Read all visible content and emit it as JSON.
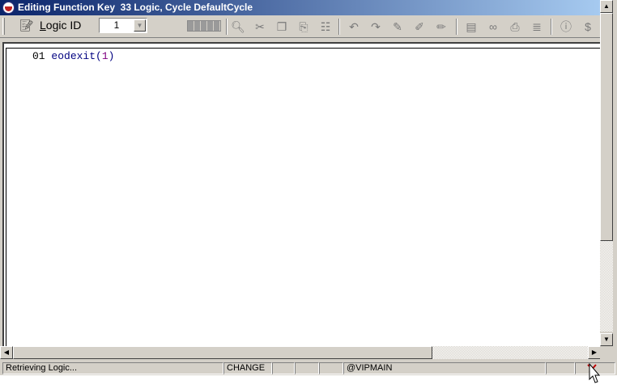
{
  "window": {
    "title": "Editing Function Key  33 Logic, Cycle DefaultCycle"
  },
  "toolbar": {
    "logic_label_u": "L",
    "logic_label_rest": "ogic ID",
    "logic_id_value": "1",
    "icons": [
      "columns-icon",
      "search-icon",
      "cut-icon",
      "copy-icon",
      "paste-icon",
      "paste-special-icon",
      "undo-icon",
      "redo-icon",
      "pencil-icon",
      "pencil-x-icon",
      "pencil-check-icon",
      "compile-icon",
      "link-icon",
      "print-icon",
      "document-icon",
      "help-icon",
      "dollar-icon"
    ]
  },
  "editor": {
    "line_number": "01",
    "code_fn": "eodexit",
    "code_open": "(",
    "code_arg": "1",
    "code_close": ")"
  },
  "statusbar": {
    "message": "Retrieving Logic...",
    "mode": "CHANGE",
    "pane3": "",
    "pane4": "",
    "pane5": "",
    "location": "@VIPMAIN",
    "pane7": ""
  },
  "colors": {
    "title_gradient_start": "#0a246a",
    "title_gradient_end": "#a6caf0",
    "code_function": "#000080",
    "code_number": "#800080"
  }
}
